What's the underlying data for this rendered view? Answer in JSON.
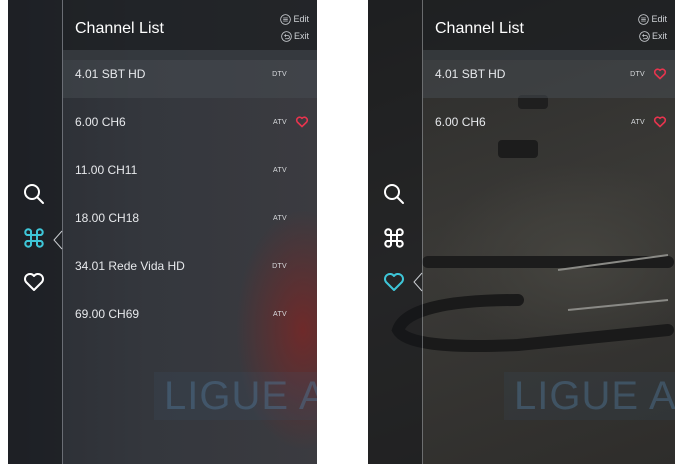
{
  "screens": [
    {
      "id": "all-channels",
      "header": {
        "title": "Channel List",
        "edit_label": "Edit",
        "exit_label": "Exit"
      },
      "nav": {
        "active": "channels"
      },
      "channels": [
        {
          "name": "4.01 SBT HD",
          "type": "DTV",
          "favorite": false,
          "selected": true
        },
        {
          "name": "6.00 CH6",
          "type": "ATV",
          "favorite": true,
          "selected": false
        },
        {
          "name": "11.00 CH11",
          "type": "ATV",
          "favorite": false,
          "selected": false
        },
        {
          "name": "18.00 CH18",
          "type": "ATV",
          "favorite": false,
          "selected": false
        },
        {
          "name": "34.01 Rede Vida HD",
          "type": "DTV",
          "favorite": false,
          "selected": false
        },
        {
          "name": "69.00 CH69",
          "type": "ATV",
          "favorite": false,
          "selected": false
        }
      ],
      "background_text": "LIGUE AGO"
    },
    {
      "id": "favorites",
      "header": {
        "title": "Channel List",
        "edit_label": "Edit",
        "exit_label": "Exit"
      },
      "nav": {
        "active": "favorites"
      },
      "channels": [
        {
          "name": "4.01 SBT HD",
          "type": "DTV",
          "favorite": true,
          "selected": true
        },
        {
          "name": "6.00 CH6",
          "type": "ATV",
          "favorite": true,
          "selected": false
        }
      ],
      "background_text": "LIGUE AGO"
    }
  ],
  "colors": {
    "accent": "#3ec6d8",
    "favorite": "#e8344e",
    "text": "#e7e9ec",
    "icon": "#ffffff"
  },
  "icons": {
    "search": "search-icon",
    "channels": "command-icon",
    "favorites": "heart-icon",
    "edit": "menu-circle-icon",
    "exit": "back-circle-icon"
  }
}
